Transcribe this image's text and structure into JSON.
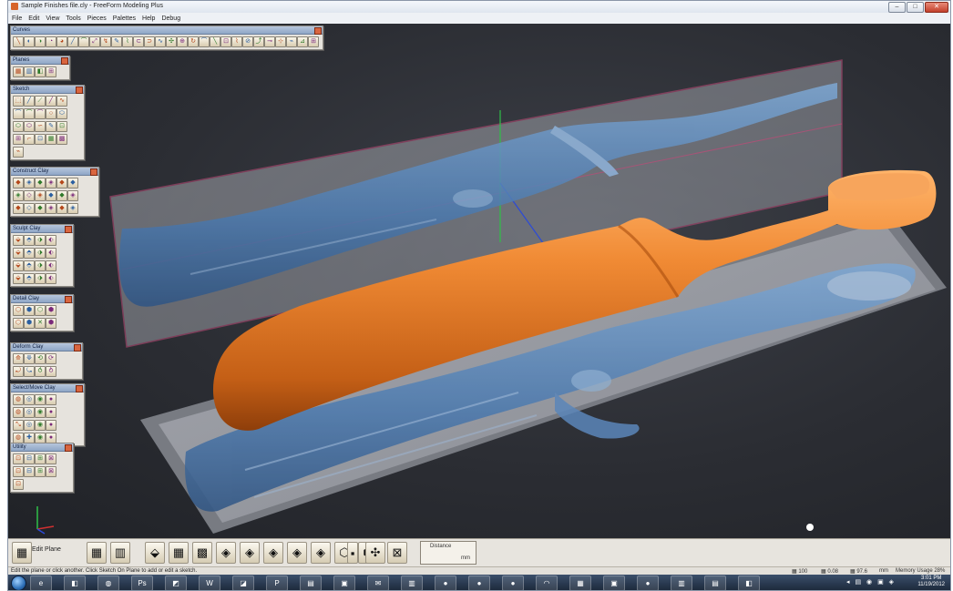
{
  "window": {
    "title": "Sample Finishes file.cly - FreeForm Modeling Plus",
    "controls": {
      "minimize": "–",
      "maximize": "□",
      "close": "✕"
    }
  },
  "menu": [
    "File",
    "Edit",
    "View",
    "Tools",
    "Pieces",
    "Palettes",
    "Help",
    "Debug"
  ],
  "palettes": [
    {
      "title": "Curves",
      "tools": [
        "╲",
        "◐",
        "◑",
        "◔",
        "◕",
        "╱",
        "⌒",
        "⤢",
        "↯",
        "✎",
        "⌇",
        "⊂",
        "⊃",
        "∿",
        "✣",
        "⊕",
        "↻",
        "⌒",
        "╲",
        "⊡",
        "⌇",
        "⊘",
        "⤴",
        "⊸",
        "⊹",
        "⌁",
        "⊿",
        "⊞"
      ]
    },
    {
      "title": "Planes",
      "tools": [
        "▦",
        "▥",
        "◧",
        "⊞"
      ]
    },
    {
      "title": "Sketch",
      "tools": [
        "⬚",
        "╱",
        "⟋",
        "╱",
        "∿",
        "⌒",
        "⌒",
        "⌒",
        "○",
        "⬭",
        "⬭",
        "⬭",
        "∽",
        "✎",
        "⊡",
        "⊞",
        "⌐",
        "⊡",
        "▦",
        "▩",
        "⌁"
      ]
    },
    {
      "title": "Construct Clay",
      "tools": [
        "◆",
        "◈",
        "◆",
        "◈",
        "◆",
        "◆",
        "◈",
        "◇",
        "◈",
        "◆",
        "◆",
        "◈",
        "◆",
        "◇",
        "◆",
        "◈",
        "◆",
        "◈"
      ]
    },
    {
      "title": "Sculpt Clay",
      "tools": [
        "⬙",
        "⬘",
        "⬗",
        "⬖",
        "⬙",
        "⬘",
        "⬗",
        "⬖",
        "⬙",
        "⬘",
        "⬗",
        "⬖",
        "⬙",
        "⬘",
        "⬗",
        "⬖"
      ]
    },
    {
      "title": "Detail Clay",
      "tools": [
        "⬡",
        "⬢",
        "⬡",
        "⬢",
        "⬡",
        "⬢",
        "✕",
        "⬢"
      ]
    },
    {
      "title": "Deform Clay",
      "tools": [
        "⟰",
        "⟱",
        "⟲",
        "⟳",
        "⤾",
        "⤿",
        "⥀",
        "⥁"
      ]
    },
    {
      "title": "Select/Move Clay",
      "tools": [
        "◍",
        "◎",
        "◉",
        "●",
        "◍",
        "◎",
        "◉",
        "●",
        "⤡",
        "◎",
        "◉",
        "●",
        "◍",
        "✚",
        "◉",
        "●"
      ]
    },
    {
      "title": "Utility",
      "tools": [
        "⊡",
        "⊟",
        "⊞",
        "⊠",
        "⊡",
        "⊟",
        "⊞",
        "⊠",
        "⊡"
      ]
    }
  ],
  "bottom_toolbar": {
    "edit_plane_label": "Edit Plane",
    "tools": [
      "▦",
      "▥",
      "⬙",
      "▦",
      "▩",
      "◈",
      "◈",
      "◈",
      "◈",
      "◈",
      "⬡",
      "⬢",
      "▪",
      "✣",
      "⊠"
    ],
    "distance_label": "Distance",
    "distance_unit": "mm"
  },
  "statusbar": {
    "message": "Edit the plane or click another. Click Sketch On Plane to add or edit a sketch.",
    "stats": [
      "▦ 100",
      "▦ 0.08",
      "▦ 97.6",
      "mm",
      "Memory Usage 28%"
    ]
  },
  "taskbar": {
    "items": [
      "e",
      "◧",
      "◍",
      "Ps",
      "◩",
      "W",
      "◪",
      "P",
      "▤",
      "▣",
      "✉",
      "▥",
      "●",
      "●",
      "●",
      "◠",
      "▦",
      "▣",
      "●",
      "▥",
      "▤",
      "◧"
    ],
    "tray": "◂ ▤ ◉ ▣ ◈",
    "clock_time": "3:01 PM",
    "clock_date": "11/19/2012"
  },
  "viewport": {
    "background": "#2a2c31",
    "clay_color": "#e27a2a",
    "ghost_color": "#4f7fb4",
    "plane_border": "#c04a78"
  }
}
